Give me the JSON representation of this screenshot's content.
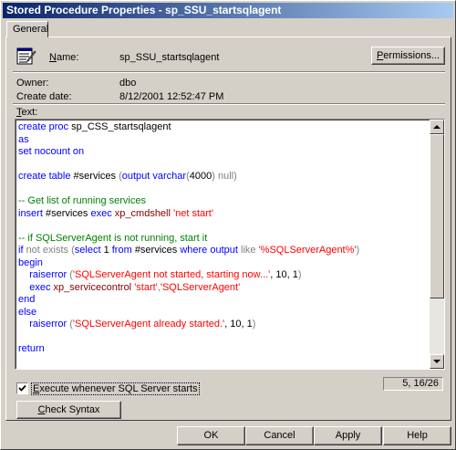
{
  "window": {
    "title": "Stored Procedure Properties - sp_SSU_startsqlagent"
  },
  "tabs": [
    {
      "label": "General"
    }
  ],
  "general": {
    "name_label": "Name:",
    "name_value": "sp_SSU_startsqlagent",
    "permissions_label": "Permissions...",
    "owner_label": "Owner:",
    "owner_value": "dbo",
    "create_date_label": "Create date:",
    "create_date_value": "8/12/2001 12:52:47 PM",
    "text_label": "Text:"
  },
  "code_lines": [
    [
      {
        "t": "create proc ",
        "c": "kw"
      },
      {
        "t": "sp_CSS_startsqlagent",
        "c": ""
      }
    ],
    [
      {
        "t": "as",
        "c": "kw"
      }
    ],
    [
      {
        "t": "set nocount on",
        "c": "kw"
      }
    ],
    [],
    [
      {
        "t": "create table ",
        "c": "kw"
      },
      {
        "t": "#services ",
        "c": ""
      },
      {
        "t": "(",
        "c": "gr"
      },
      {
        "t": "output ",
        "c": "kw"
      },
      {
        "t": "varchar",
        "c": "kw"
      },
      {
        "t": "(",
        "c": "gr"
      },
      {
        "t": "4000",
        "c": ""
      },
      {
        "t": ") ",
        "c": "gr"
      },
      {
        "t": "null",
        "c": "gr"
      },
      {
        "t": ")",
        "c": "gr"
      }
    ],
    [],
    [
      {
        "t": "-- Get list of running services",
        "c": "cm"
      }
    ],
    [
      {
        "t": "insert ",
        "c": "kw"
      },
      {
        "t": "#services ",
        "c": ""
      },
      {
        "t": "exec ",
        "c": "kw"
      },
      {
        "t": "xp_cmdshell ",
        "c": "fn"
      },
      {
        "t": "'net start'",
        "c": "st"
      }
    ],
    [],
    [
      {
        "t": "-- if SQLServerAgent is not running, start it",
        "c": "cm"
      }
    ],
    [
      {
        "t": "if ",
        "c": "kw"
      },
      {
        "t": "not exists ",
        "c": "gr"
      },
      {
        "t": "(",
        "c": "gr"
      },
      {
        "t": "select ",
        "c": "kw"
      },
      {
        "t": "1 ",
        "c": ""
      },
      {
        "t": "from ",
        "c": "kw"
      },
      {
        "t": "#services ",
        "c": ""
      },
      {
        "t": "where ",
        "c": "kw"
      },
      {
        "t": "output ",
        "c": "kw"
      },
      {
        "t": "like ",
        "c": "gr"
      },
      {
        "t": "'%SQLServerAgent%'",
        "c": "st"
      },
      {
        "t": ")",
        "c": "gr"
      }
    ],
    [
      {
        "t": "begin",
        "c": "kw"
      }
    ],
    [
      {
        "t": "    raiserror ",
        "c": "kw"
      },
      {
        "t": "(",
        "c": "gr"
      },
      {
        "t": "'SQLServerAgent not started, starting now...'",
        "c": "st"
      },
      {
        "t": ", 10, 1",
        "c": ""
      },
      {
        "t": ")",
        "c": "gr"
      }
    ],
    [
      {
        "t": "    exec ",
        "c": "kw"
      },
      {
        "t": "xp_servicecontrol ",
        "c": "fn"
      },
      {
        "t": "'start'",
        "c": "st"
      },
      {
        "t": ",",
        "c": "gr"
      },
      {
        "t": "'SQLServerAgent'",
        "c": "st"
      }
    ],
    [
      {
        "t": "end",
        "c": "kw"
      }
    ],
    [
      {
        "t": "else",
        "c": "kw"
      }
    ],
    [
      {
        "t": "    raiserror ",
        "c": "kw"
      },
      {
        "t": "(",
        "c": "gr"
      },
      {
        "t": "'SQLServerAgent already started.'",
        "c": "st"
      },
      {
        "t": ", 10, 1",
        "c": ""
      },
      {
        "t": ")",
        "c": "gr"
      }
    ],
    [],
    [
      {
        "t": "return",
        "c": "kw"
      }
    ]
  ],
  "execute_on_start": {
    "label": "Execute whenever SQL Server starts",
    "checked": true
  },
  "cursor_position": "5, 16/26",
  "check_syntax_label": "Check Syntax",
  "buttons": {
    "ok": "OK",
    "cancel": "Cancel",
    "apply": "Apply",
    "help": "Help"
  },
  "colors": {
    "title_start": "#0a246a",
    "title_end": "#a6caf0",
    "keyword": "#0000ff",
    "comment": "#008000",
    "string": "#ff0000",
    "system_proc": "#800000",
    "operator": "#808080"
  }
}
